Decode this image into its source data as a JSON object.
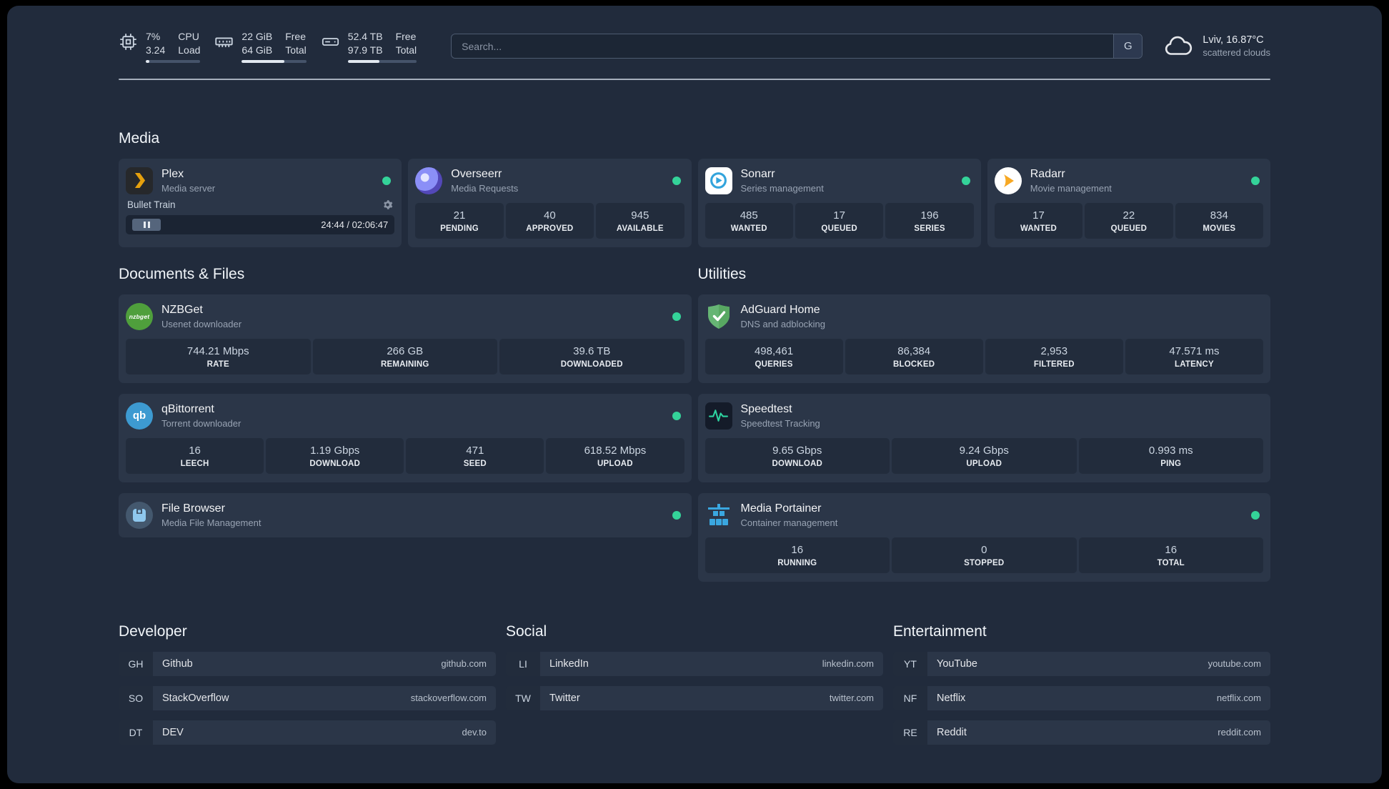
{
  "colors": {
    "background": "#212b3c",
    "card": "#2b3648",
    "stat_box": "#222c3c",
    "status_online": "#34d399",
    "plex_accent": "#e5a00d",
    "speedtest_accent": "#2dd4a0",
    "adguard_green": "#66b574",
    "portainer_blue": "#3aa7e0"
  },
  "topbar": {
    "resources": [
      {
        "icon": "cpu-icon",
        "col1_top": "7%",
        "col1_bottom": "3.24",
        "col2_top": "CPU",
        "col2_bottom": "Load",
        "percent_used": 7
      },
      {
        "icon": "memory-icon",
        "col1_top": "22 GiB",
        "col1_bottom": "64 GiB",
        "col2_top": "Free",
        "col2_bottom": "Total",
        "percent_used": 66
      },
      {
        "icon": "disk-icon",
        "col1_top": "52.4 TB",
        "col1_bottom": "97.9 TB",
        "col2_top": "Free",
        "col2_bottom": "Total",
        "percent_used": 46
      }
    ],
    "search": {
      "placeholder": "Search...",
      "provider_label": "G"
    },
    "weather": {
      "location": "Lviv, 16.87°C",
      "condition": "scattered clouds"
    }
  },
  "icons": {
    "nzbget_label": "nzbget",
    "qbittorrent_label": "qb"
  },
  "media": {
    "title": "Media",
    "cards": [
      {
        "title": "Plex",
        "subtitle": "Media server",
        "online": true,
        "player": {
          "track": "Bullet Train",
          "time": "24:44 / 02:06:47"
        }
      },
      {
        "title": "Overseerr",
        "subtitle": "Media Requests",
        "online": true,
        "stats": [
          {
            "value": "21",
            "label": "PENDING"
          },
          {
            "value": "40",
            "label": "APPROVED"
          },
          {
            "value": "945",
            "label": "AVAILABLE"
          }
        ]
      },
      {
        "title": "Sonarr",
        "subtitle": "Series management",
        "online": true,
        "stats": [
          {
            "value": "485",
            "label": "WANTED"
          },
          {
            "value": "17",
            "label": "QUEUED"
          },
          {
            "value": "196",
            "label": "SERIES"
          }
        ]
      },
      {
        "title": "Radarr",
        "subtitle": "Movie management",
        "online": true,
        "stats": [
          {
            "value": "17",
            "label": "WANTED"
          },
          {
            "value": "22",
            "label": "QUEUED"
          },
          {
            "value": "834",
            "label": "MOVIES"
          }
        ]
      }
    ]
  },
  "documents": {
    "title": "Documents & Files",
    "cards": [
      {
        "title": "NZBGet",
        "subtitle": "Usenet downloader",
        "online": true,
        "stats": [
          {
            "value": "744.21 Mbps",
            "label": "RATE"
          },
          {
            "value": "266 GB",
            "label": "REMAINING"
          },
          {
            "value": "39.6 TB",
            "label": "DOWNLOADED"
          }
        ]
      },
      {
        "title": "qBittorrent",
        "subtitle": "Torrent downloader",
        "online": true,
        "stats": [
          {
            "value": "16",
            "label": "LEECH"
          },
          {
            "value": "1.19 Gbps",
            "label": "DOWNLOAD"
          },
          {
            "value": "471",
            "label": "SEED"
          },
          {
            "value": "618.52 Mbps",
            "label": "UPLOAD"
          }
        ]
      },
      {
        "title": "File Browser",
        "subtitle": "Media File Management",
        "online": true
      }
    ]
  },
  "utilities": {
    "title": "Utilities",
    "cards": [
      {
        "title": "AdGuard Home",
        "subtitle": "DNS and adblocking",
        "stats": [
          {
            "value": "498,461",
            "label": "QUERIES"
          },
          {
            "value": "86,384",
            "label": "BLOCKED"
          },
          {
            "value": "2,953",
            "label": "FILTERED"
          },
          {
            "value": "47.571 ms",
            "label": "LATENCY"
          }
        ]
      },
      {
        "title": "Speedtest",
        "subtitle": "Speedtest Tracking",
        "stats": [
          {
            "value": "9.65 Gbps",
            "label": "DOWNLOAD"
          },
          {
            "value": "9.24 Gbps",
            "label": "UPLOAD"
          },
          {
            "value": "0.993 ms",
            "label": "PING"
          }
        ]
      },
      {
        "title": "Media Portainer",
        "subtitle": "Container management",
        "online": true,
        "stats": [
          {
            "value": "16",
            "label": "RUNNING"
          },
          {
            "value": "0",
            "label": "STOPPED"
          },
          {
            "value": "16",
            "label": "TOTAL"
          }
        ]
      }
    ]
  },
  "bookmarks": {
    "groups": [
      {
        "title": "Developer",
        "items": [
          {
            "abbr": "GH",
            "name": "Github",
            "domain": "github.com"
          },
          {
            "abbr": "SO",
            "name": "StackOverflow",
            "domain": "stackoverflow.com"
          },
          {
            "abbr": "DT",
            "name": "DEV",
            "domain": "dev.to"
          }
        ]
      },
      {
        "title": "Social",
        "items": [
          {
            "abbr": "LI",
            "name": "LinkedIn",
            "domain": "linkedin.com"
          },
          {
            "abbr": "TW",
            "name": "Twitter",
            "domain": "twitter.com"
          }
        ]
      },
      {
        "title": "Entertainment",
        "items": [
          {
            "abbr": "YT",
            "name": "YouTube",
            "domain": "youtube.com"
          },
          {
            "abbr": "NF",
            "name": "Netflix",
            "domain": "netflix.com"
          },
          {
            "abbr": "RE",
            "name": "Reddit",
            "domain": "reddit.com"
          }
        ]
      }
    ]
  }
}
